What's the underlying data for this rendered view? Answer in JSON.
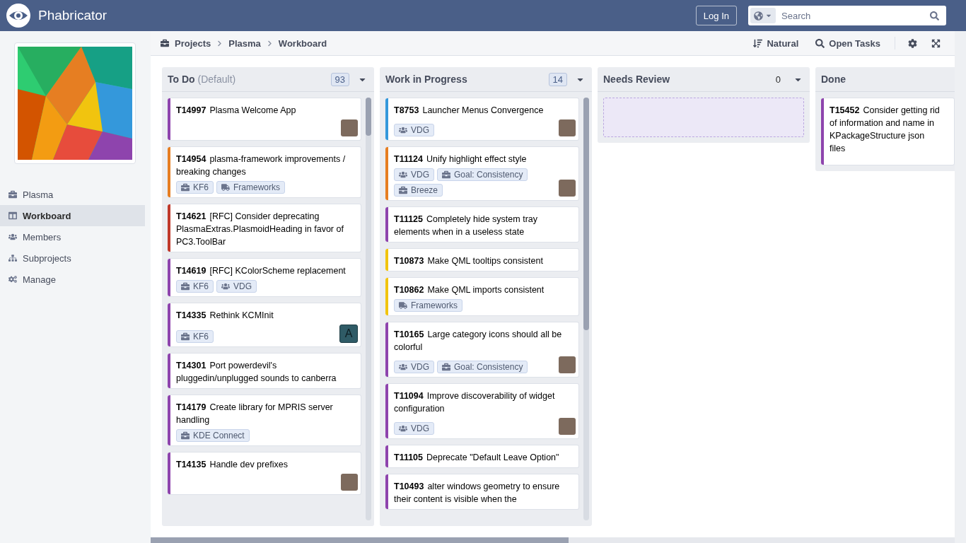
{
  "header": {
    "app_name": "Phabricator",
    "login_label": "Log In",
    "search": {
      "placeholder": "Search"
    }
  },
  "sidebar": {
    "items": [
      {
        "label": "Plasma",
        "selected": false
      },
      {
        "label": "Workboard",
        "selected": true
      },
      {
        "label": "Members",
        "selected": false
      },
      {
        "label": "Subprojects",
        "selected": false
      },
      {
        "label": "Manage",
        "selected": false
      }
    ]
  },
  "breadcrumbs": [
    "Projects",
    "Plasma",
    "Workboard"
  ],
  "actions": [
    {
      "label": "Natural"
    },
    {
      "label": "Open Tasks"
    }
  ],
  "columns": [
    {
      "title": "To Do",
      "subtitle": "(Default)",
      "count": "93",
      "count_boxed": true,
      "tasks": [
        {
          "id": "T14997",
          "title": "Plasma Welcome App",
          "color": "#8e44ad",
          "avatar": {
            "kind": "photo"
          }
        },
        {
          "id": "T14954",
          "title": "plasma-framework improvements / breaking changes",
          "color": "#e67e22",
          "tags": [
            {
              "kind": "project",
              "label": "KF6"
            },
            {
              "kind": "milestone",
              "label": "Frameworks"
            }
          ]
        },
        {
          "id": "T14621",
          "title": "[RFC] Consider deprecating PlasmaExtras.PlasmoidHeading in favor of PC3.ToolBar",
          "color": "#c0392b"
        },
        {
          "id": "T14619",
          "title": "[RFC] KColorScheme replacement",
          "color": "#8e44ad",
          "tags": [
            {
              "kind": "project",
              "label": "KF6"
            },
            {
              "kind": "group",
              "label": "VDG"
            }
          ]
        },
        {
          "id": "T14335",
          "title": "Rethink KCMInit",
          "color": "#8e44ad",
          "tags": [
            {
              "kind": "project",
              "label": "KF6"
            }
          ],
          "avatar": {
            "kind": "letter",
            "letter": "A"
          }
        },
        {
          "id": "T14301",
          "title": "Port powerdevil's pluggedin/unplugged sounds to canberra",
          "color": "#8e44ad"
        },
        {
          "id": "T14179",
          "title": "Create library for MPRIS server handling",
          "color": "#8e44ad",
          "tags": [
            {
              "kind": "project",
              "label": "KDE Connect"
            }
          ]
        },
        {
          "id": "T14135",
          "title": "Handle dev prefixes",
          "color": "#8e44ad",
          "avatar": {
            "kind": "photo"
          }
        }
      ]
    },
    {
      "title": "Work in Progress",
      "count": "14",
      "count_boxed": true,
      "tasks": [
        {
          "id": "T8753",
          "title": "Launcher Menus Convergence",
          "color": "#3498db",
          "tags": [
            {
              "kind": "group",
              "label": "VDG"
            }
          ],
          "avatar": {
            "kind": "photo"
          }
        },
        {
          "id": "T11124",
          "title": "Unify highlight effect style",
          "color": "#e67e22",
          "tags": [
            {
              "kind": "group",
              "label": "VDG"
            },
            {
              "kind": "project",
              "label": "Goal: Consistency"
            },
            {
              "kind": "project",
              "label": "Breeze"
            }
          ],
          "avatar": {
            "kind": "photo"
          }
        },
        {
          "id": "T11125",
          "title": "Completely hide system tray elements when in a useless state",
          "color": "#8e44ad"
        },
        {
          "id": "T10873",
          "title": "Make QML tooltips consistent",
          "color": "#f1c40f"
        },
        {
          "id": "T10862",
          "title": "Make QML imports consistent",
          "color": "#f1c40f",
          "tags": [
            {
              "kind": "milestone",
              "label": "Frameworks"
            }
          ]
        },
        {
          "id": "T10165",
          "title": "Large category icons should all be colorful",
          "color": "#8e44ad",
          "tags": [
            {
              "kind": "group",
              "label": "VDG"
            },
            {
              "kind": "project",
              "label": "Goal: Consistency"
            }
          ],
          "avatar": {
            "kind": "photo"
          }
        },
        {
          "id": "T11094",
          "title": "Improve discoverability of widget configuration",
          "color": "#8e44ad",
          "tags": [
            {
              "kind": "group",
              "label": "VDG"
            }
          ],
          "avatar": {
            "kind": "photo"
          }
        },
        {
          "id": "T11105",
          "title": "Deprecate \"Default Leave Option\"",
          "color": "#8e44ad"
        },
        {
          "id": "T10493",
          "title": "alter windows geometry to ensure their content is visible when the",
          "color": "#8e44ad"
        }
      ]
    },
    {
      "title": "Needs Review",
      "count": "0",
      "count_boxed": false
    },
    {
      "title": "Done",
      "tasks": [
        {
          "id": "T15452",
          "title": "Consider getting rid of information and name in KPackageStructure json files",
          "color": "#8e44ad"
        }
      ]
    }
  ]
}
